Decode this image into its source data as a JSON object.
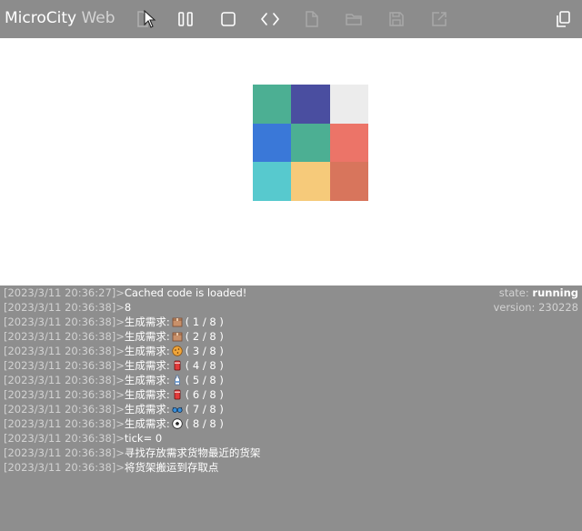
{
  "app": {
    "name_main": "MicroCity",
    "name_sub": "Web"
  },
  "toolbar": {
    "buttons": [
      "run-icon",
      "pause-icon",
      "stop-icon",
      "code-icon",
      "new-file-icon",
      "open-folder-icon",
      "save-icon",
      "export-icon"
    ],
    "right_button": "copy-icon"
  },
  "grid": {
    "colors": [
      "#4caf93",
      "#4a4ea0",
      "#ececec",
      "#3a78d8",
      "#4caf93",
      "#ec7468",
      "#57c9ce",
      "#f6ca7a",
      "#d8755c"
    ]
  },
  "console": {
    "status": {
      "state_label": "state:",
      "state_value": "running",
      "version_label": "version:",
      "version_value": "230228"
    },
    "lines": [
      {
        "ts": "[2023/3/11 20:36:27]",
        "sep": ">",
        "msg": "Cached code is loaded!"
      },
      {
        "ts": "[2023/3/11 20:36:38]",
        "sep": ">",
        "msg": "8"
      },
      {
        "ts": "[2023/3/11 20:36:38]",
        "sep": ">",
        "msg": "生成需求:",
        "icon": "box-icon",
        "tail": "( 1 / 8 )"
      },
      {
        "ts": "[2023/3/11 20:36:38]",
        "sep": ">",
        "msg": "生成需求:",
        "icon": "box-icon",
        "tail": "( 2 / 8 )"
      },
      {
        "ts": "[2023/3/11 20:36:38]",
        "sep": ">",
        "msg": "生成需求:",
        "icon": "cookie-icon",
        "tail": "( 3 / 8 )"
      },
      {
        "ts": "[2023/3/11 20:36:38]",
        "sep": ">",
        "msg": "生成需求:",
        "icon": "drink-icon",
        "tail": "( 4 / 8 )"
      },
      {
        "ts": "[2023/3/11 20:36:38]",
        "sep": ">",
        "msg": "生成需求:",
        "icon": "milk-bottle-icon",
        "tail": "( 5 / 8 )"
      },
      {
        "ts": "[2023/3/11 20:36:38]",
        "sep": ">",
        "msg": "生成需求:",
        "icon": "drink-icon",
        "tail": "( 6 / 8 )"
      },
      {
        "ts": "[2023/3/11 20:36:38]",
        "sep": ">",
        "msg": "生成需求:",
        "icon": "glasses-icon",
        "tail": "( 7 / 8 )"
      },
      {
        "ts": "[2023/3/11 20:36:38]",
        "sep": ">",
        "msg": "生成需求:",
        "icon": "soccer-ball-icon",
        "tail": "( 8 / 8 )"
      },
      {
        "ts": "[2023/3/11 20:36:38]",
        "sep": ">",
        "msg": "tick= 0"
      },
      {
        "ts": "[2023/3/11 20:36:38]",
        "sep": ">",
        "msg": "寻找存放需求货物最近的货架"
      },
      {
        "ts": "[2023/3/11 20:36:38]",
        "sep": ">",
        "msg": "将货架搬运到存取点"
      }
    ]
  }
}
